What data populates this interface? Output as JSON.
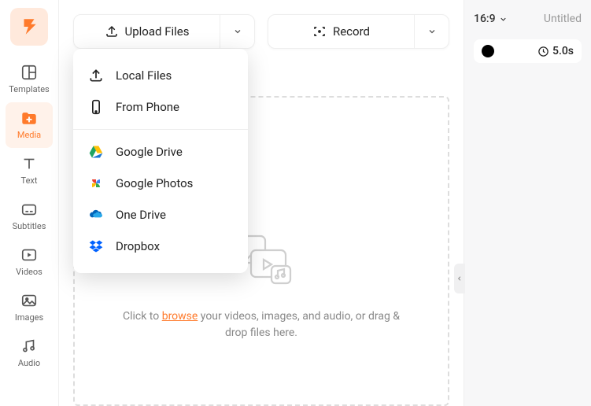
{
  "sidebar": {
    "items": [
      {
        "label": "Templates"
      },
      {
        "label": "Media"
      },
      {
        "label": "Text"
      },
      {
        "label": "Subtitles"
      },
      {
        "label": "Videos"
      },
      {
        "label": "Images"
      },
      {
        "label": "Audio"
      }
    ]
  },
  "toolbar": {
    "upload_label": "Upload Files",
    "record_label": "Record"
  },
  "upload_menu": {
    "local": "Local Files",
    "phone": "From Phone",
    "gdrive": "Google Drive",
    "gphotos": "Google Photos",
    "onedrive": "One Drive",
    "dropbox": "Dropbox"
  },
  "dropzone": {
    "prefix": "Click to ",
    "link": "browse",
    "suffix": " your videos, images, and audio, or drag & drop files here."
  },
  "right": {
    "ratio": "16:9",
    "title": "Untitled",
    "duration": "5.0s"
  }
}
